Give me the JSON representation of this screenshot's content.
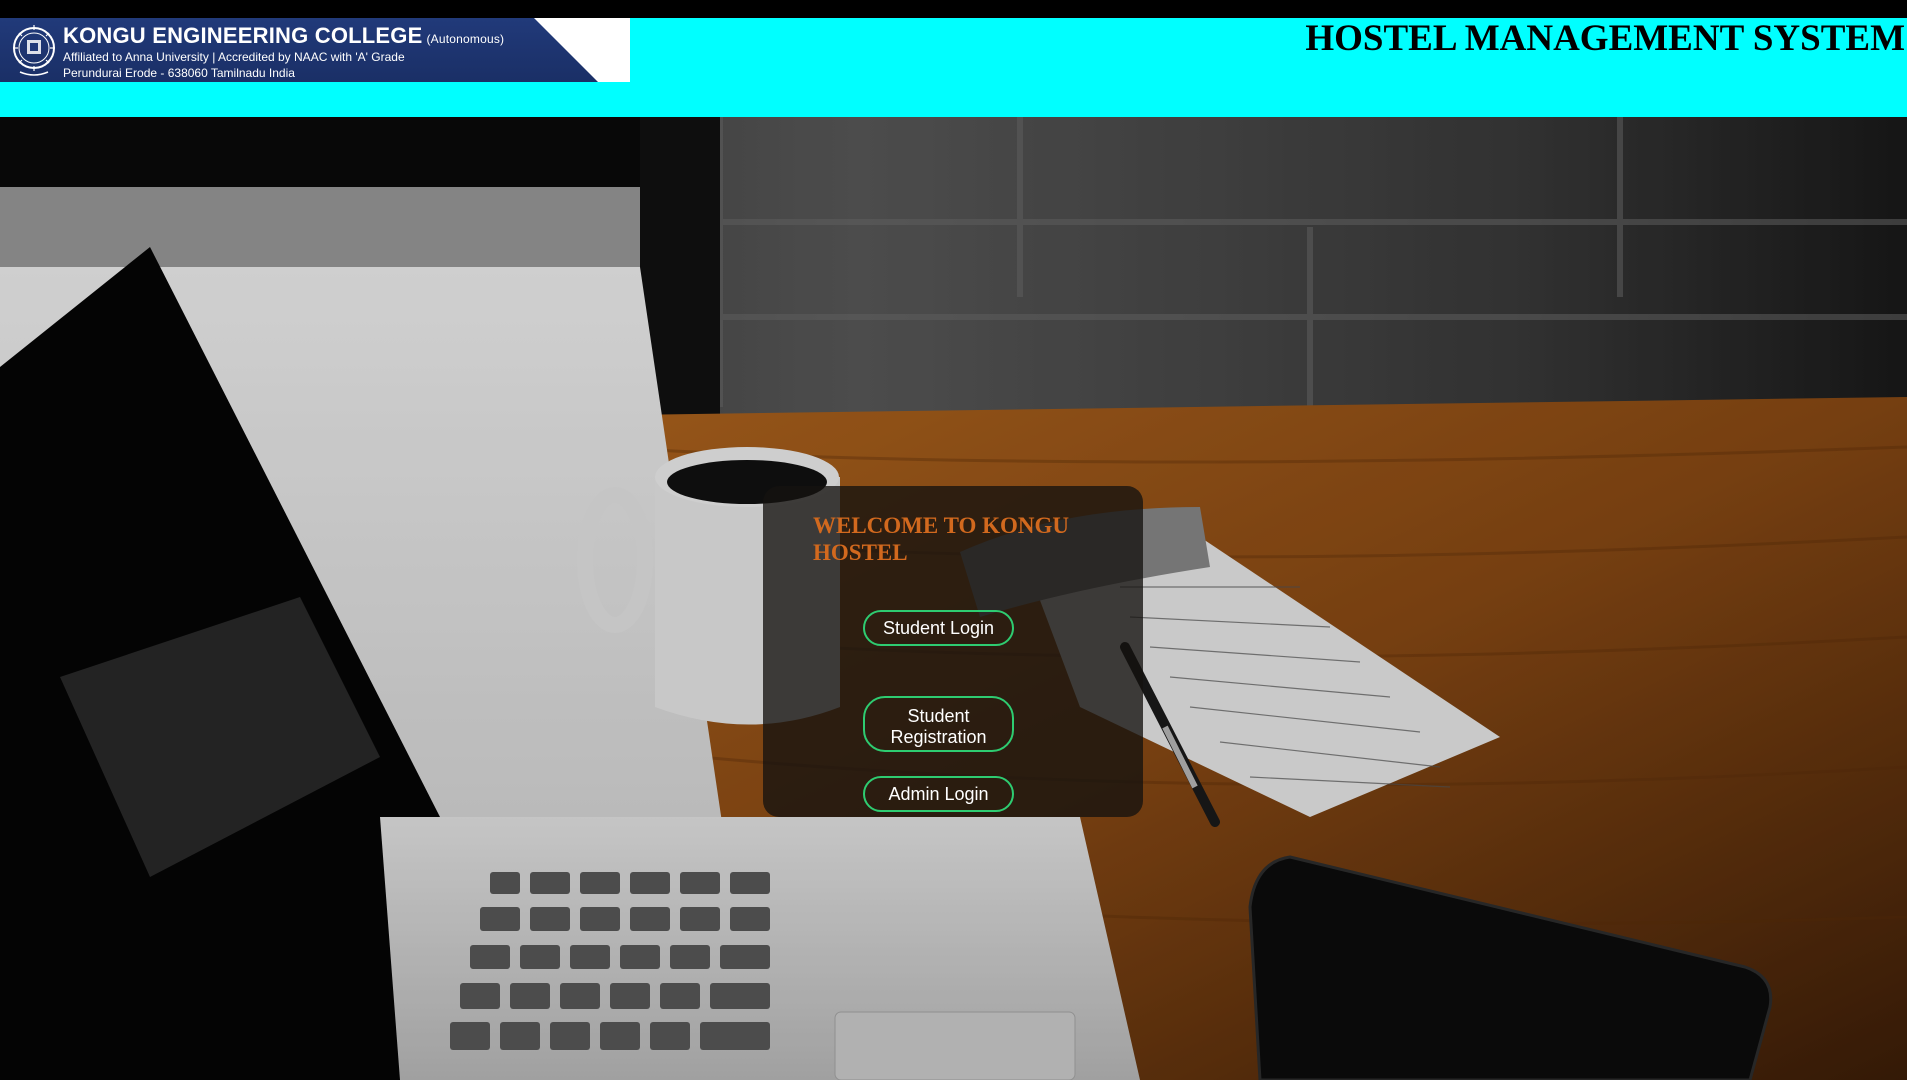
{
  "header": {
    "college_name": "KONGU ENGINEERING COLLEGE",
    "autonomous": "(Autonomous)",
    "affiliation": "Affiliated to Anna University  |  Accredited by NAAC with 'A' Grade",
    "address": "Perundurai  Erode - 638060 Tamilnadu India",
    "system_title": "HOSTEL MANAGEMENT SYSTEM",
    "header_color": "#00ffff",
    "banner_color": "#1f3671"
  },
  "panel": {
    "welcome": "WELCOME TO KONGU HOSTEL",
    "welcome_color": "#d2691e",
    "buttons": {
      "student_login": "Student Login",
      "student_registration_line1": "Student",
      "student_registration_line2": "Registration",
      "admin_login": "Admin Login"
    },
    "button_border_color": "#2ecc71"
  },
  "icons": {
    "seal": "college-seal-icon"
  }
}
